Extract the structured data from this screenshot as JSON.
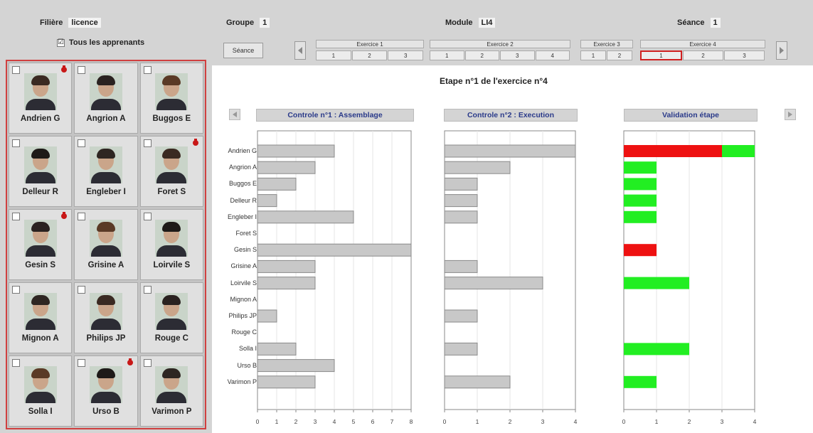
{
  "header": {
    "filiere_label": "Filière",
    "filiere_value": "licence",
    "groupe_label": "Groupe",
    "groupe_value": "1",
    "module_label": "Module",
    "module_value": "LI4",
    "seance_label": "Séance",
    "seance_value": "1"
  },
  "learners": {
    "all_label": "Tous les apprenants",
    "all_checked": true,
    "items": [
      {
        "name": "Andrien G",
        "alert": true
      },
      {
        "name": "Angrion A",
        "alert": false
      },
      {
        "name": "Buggos E",
        "alert": false
      },
      {
        "name": "Delleur R",
        "alert": false
      },
      {
        "name": "Engleber I",
        "alert": false
      },
      {
        "name": "Foret S",
        "alert": true
      },
      {
        "name": "Gesin S",
        "alert": true
      },
      {
        "name": "Grisine A",
        "alert": false
      },
      {
        "name": "Loirvile S",
        "alert": false
      },
      {
        "name": "Mignon A",
        "alert": false
      },
      {
        "name": "Philips JP",
        "alert": false
      },
      {
        "name": "Rouge C",
        "alert": false
      },
      {
        "name": "Solla I",
        "alert": false
      },
      {
        "name": "Urso B",
        "alert": true
      },
      {
        "name": "Varimon P",
        "alert": false
      }
    ]
  },
  "nav": {
    "seance_button": "Séance",
    "exercises": [
      {
        "label": "Exercice 1",
        "steps": [
          "1",
          "2",
          "3"
        ]
      },
      {
        "label": "Exercice 2",
        "steps": [
          "1",
          "2",
          "3",
          "4"
        ]
      },
      {
        "label": "Exercice 3",
        "steps": [
          "1",
          "2"
        ]
      },
      {
        "label": "Exercice 4",
        "steps": [
          "1",
          "2",
          "3"
        ]
      }
    ],
    "selected_exercise": 4,
    "selected_step": 1
  },
  "main": {
    "step_title": "Etape n°1 de l'exercice n°4",
    "panel1_title": "Controle n°1 : Assemblage",
    "panel2_title": "Controle n°2 : Execution",
    "panel3_title": "Validation étape",
    "row_labels": [
      "Andrien G",
      "Angrion A",
      "Buggos E",
      "Delleur R",
      "Engleber I",
      "Foret S",
      "Gesin S",
      "Grisine A",
      "Loirvile S",
      "Mignon A",
      "Philips JP",
      "Rouge C",
      "Solla I",
      "Urso B",
      "Varimon P"
    ]
  },
  "chart_data": [
    {
      "type": "bar",
      "orientation": "horizontal",
      "title": "Controle n°1 : Assemblage",
      "categories": [
        "Andrien G",
        "Angrion A",
        "Buggos E",
        "Delleur R",
        "Engleber I",
        "Foret S",
        "Gesin S",
        "Grisine A",
        "Loirvile S",
        "Mignon A",
        "Philips JP",
        "Rouge C",
        "Solla I",
        "Urso B",
        "Varimon P"
      ],
      "values": [
        4,
        3,
        2,
        1,
        5,
        0,
        8,
        3,
        3,
        0,
        1,
        0,
        2,
        4,
        3
      ],
      "xlim": [
        0,
        8
      ],
      "ticks": [
        "0",
        "1",
        "2",
        "3",
        "4",
        "5",
        "6",
        "7",
        "8"
      ],
      "color": "#c8c8c8",
      "grid": true
    },
    {
      "type": "bar",
      "orientation": "horizontal",
      "title": "Controle n°2 : Execution",
      "categories": [
        "Andrien G",
        "Angrion A",
        "Buggos E",
        "Delleur R",
        "Engleber I",
        "Foret S",
        "Gesin S",
        "Grisine A",
        "Loirvile S",
        "Mignon A",
        "Philips JP",
        "Rouge C",
        "Solla I",
        "Urso B",
        "Varimon P"
      ],
      "values": [
        4,
        2,
        1,
        1,
        1,
        0,
        0,
        1,
        3,
        0,
        1,
        0,
        1,
        0,
        2
      ],
      "xlim": [
        0,
        4
      ],
      "ticks": [
        "0",
        "1",
        "2",
        "3",
        "4"
      ],
      "color": "#c8c8c8",
      "grid": true
    },
    {
      "type": "bar",
      "orientation": "horizontal",
      "stacked": true,
      "title": "Validation étape",
      "categories": [
        "Andrien G",
        "Angrion A",
        "Buggos E",
        "Delleur R",
        "Engleber I",
        "Foret S",
        "Gesin S",
        "Grisine A",
        "Loirvile S",
        "Mignon A",
        "Philips JP",
        "Rouge C",
        "Solla I",
        "Urso B",
        "Varimon P"
      ],
      "series": [
        {
          "color": "#ee1111",
          "values": [
            3,
            0,
            0,
            0,
            0,
            0,
            1,
            0,
            0,
            0,
            0,
            0,
            0,
            0,
            0
          ]
        },
        {
          "color": "#22ee22",
          "values": [
            1,
            1,
            1,
            1,
            1,
            0,
            0,
            0,
            2,
            0,
            0,
            0,
            2,
            0,
            1
          ]
        }
      ],
      "xlim": [
        0,
        4
      ],
      "ticks": [
        "0",
        "1",
        "2",
        "3",
        "4"
      ],
      "grid": true
    }
  ]
}
